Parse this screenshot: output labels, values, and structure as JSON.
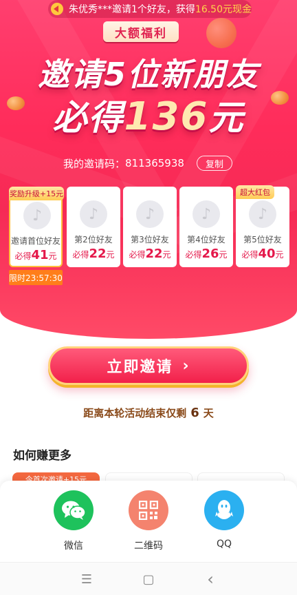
{
  "notice": {
    "text": "朱优秀***邀请1个好友，获得",
    "amount": "16.50元现金"
  },
  "hero": {
    "badge": "大额福利",
    "headline_line1": "邀请5位新朋友",
    "headline_line2_prefix": "必得",
    "headline_line2_number": "136",
    "headline_line2_suffix": "元",
    "invite_code_label": "我的邀请码：",
    "invite_code": "811365938",
    "copy_label": "复制"
  },
  "friend_cards": [
    {
      "tag": "奖励升级+15元",
      "who": "邀请首位好友",
      "gain_prefix": "必得",
      "amount": "41",
      "unit": "元"
    },
    {
      "tag": "",
      "who": "第2位好友",
      "gain_prefix": "必得",
      "amount": "22",
      "unit": "元"
    },
    {
      "tag": "",
      "who": "第3位好友",
      "gain_prefix": "必得",
      "amount": "22",
      "unit": "元"
    },
    {
      "tag": "",
      "who": "第4位好友",
      "gain_prefix": "必得",
      "amount": "26",
      "unit": "元"
    },
    {
      "tag": "超大红包",
      "who": "第5位好友",
      "gain_prefix": "必得",
      "amount": "40",
      "unit": "元"
    }
  ],
  "limit_timer": "限时23:57:30",
  "invite_button": {
    "label": "立即邀请",
    "arrow": "›"
  },
  "countdown": {
    "prefix": "距离本轮活动结束仅剩",
    "days": "6",
    "suffix": "天"
  },
  "more_section": {
    "title": "如何赚更多",
    "hot_task": "今首次邀请+15元"
  },
  "share": [
    {
      "label": "微信",
      "icon": "wechat-icon",
      "color": "#1ec25c"
    },
    {
      "label": "二维码",
      "icon": "qrcode-icon",
      "color": "#f4836e"
    },
    {
      "label": "QQ",
      "icon": "qq-icon",
      "color": "#2bb0f0"
    }
  ],
  "system_nav": {
    "menu": "☰",
    "home": "▢",
    "back": "‹"
  }
}
